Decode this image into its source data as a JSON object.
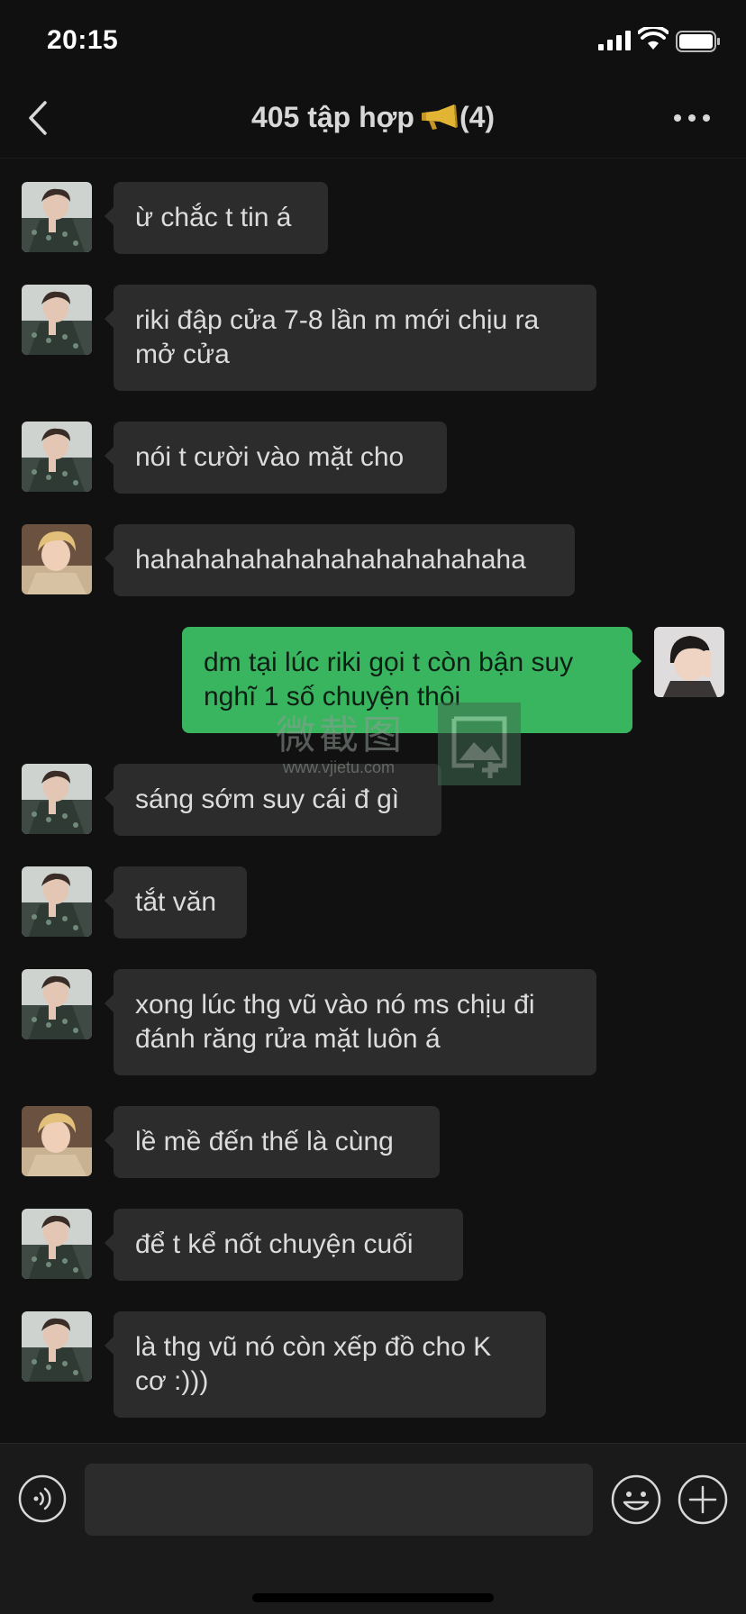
{
  "status_bar": {
    "time": "20:15",
    "icons": [
      "signal-icon",
      "wifi-icon",
      "battery-icon"
    ]
  },
  "header": {
    "title": "405 tập hợp",
    "title_icon": "megaphone-icon",
    "member_count": "(4)",
    "back_icon": "chevron-left-icon",
    "more_icon": "more-icon"
  },
  "messages": [
    {
      "sender": "friend-a",
      "side": "left",
      "text": "ừ chắc t tin á"
    },
    {
      "sender": "friend-a",
      "side": "left",
      "text": "riki đập cửa 7-8 lần m mới chịu ra mở cửa"
    },
    {
      "sender": "friend-a",
      "side": "left",
      "text": "nói t cười vào mặt cho"
    },
    {
      "sender": "friend-b",
      "side": "left",
      "text": "hahahahahahahahahahahahaha"
    },
    {
      "sender": "me",
      "side": "right",
      "text": "dm tại lúc riki gọi t còn bận suy nghĩ 1 số chuyện thôi"
    },
    {
      "sender": "friend-a",
      "side": "left",
      "text": "sáng sớm suy cái đ gì"
    },
    {
      "sender": "friend-a",
      "side": "left",
      "text": "tắt văn"
    },
    {
      "sender": "friend-a",
      "side": "left",
      "text": "xong lúc thg vũ vào nó ms chịu đi đánh răng rửa mặt luôn á"
    },
    {
      "sender": "friend-b",
      "side": "left",
      "text": "lề mề đến thế là cùng"
    },
    {
      "sender": "friend-a",
      "side": "left",
      "text": "để t kể nốt chuyện cuối"
    },
    {
      "sender": "friend-a",
      "side": "left",
      "text": "là thg vũ nó còn xếp đồ cho K cơ :)))"
    }
  ],
  "watermark": {
    "text": "微截图",
    "url": "www.vjietu.com"
  },
  "input_bar": {
    "voice_icon": "voice-icon",
    "input_value": "",
    "emoji_icon": "emoji-icon",
    "plus_icon": "plus-icon"
  },
  "colors": {
    "background": "#111111",
    "bubble_other": "#2c2c2c",
    "bubble_me": "#3ab55f"
  }
}
